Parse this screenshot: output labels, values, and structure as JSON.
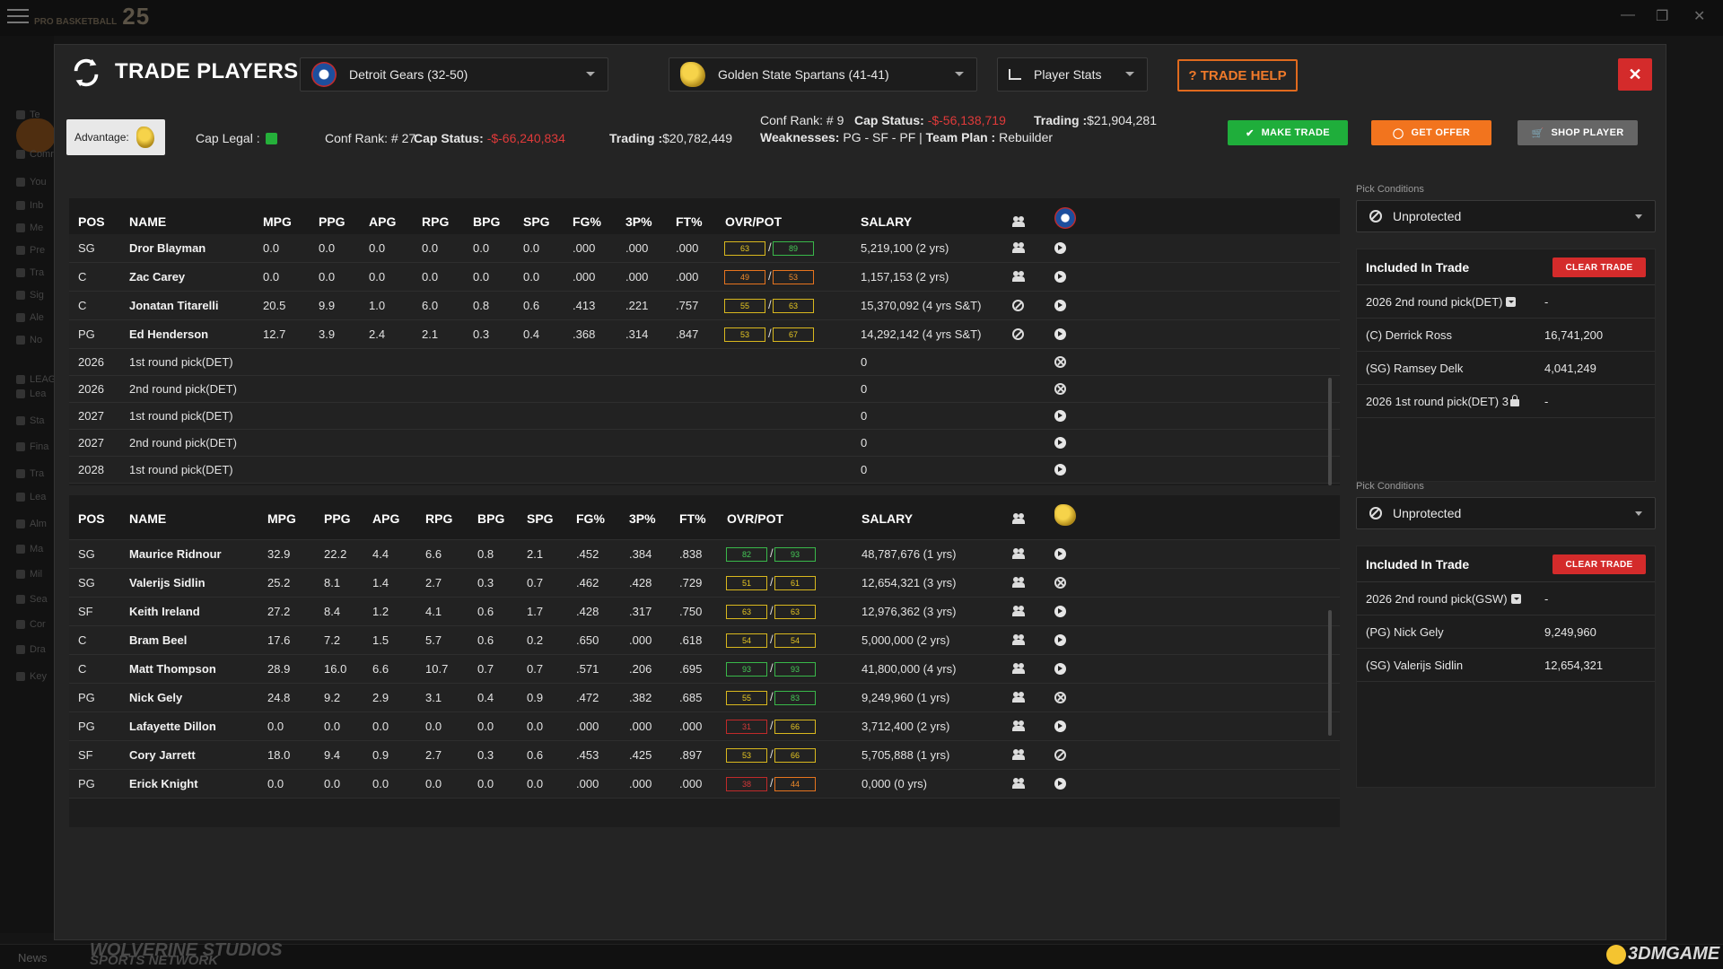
{
  "app": {
    "logo_small": "PRO BASKETBALL",
    "logo_year": "25",
    "news_label": "News",
    "studio": "WOLVERINE STUDIOS",
    "studio_sub": "SPORTS NETWORK",
    "watermark": "3DMGAME",
    "sidebar": [
      "Te",
      "Comr",
      "You",
      "Inb",
      "Me",
      "Pre",
      "Tra",
      "Sig",
      "Ale",
      "No",
      "LEAGUE",
      "Lea",
      "Sta",
      "Fina",
      "Tra",
      "Lea",
      "Alm",
      "Ma",
      "Mil",
      "Sea",
      "Cor",
      "Dra",
      "Key"
    ]
  },
  "modal": {
    "title": "TRADE PLAYERS",
    "team_left": "Detroit Gears (32-50)",
    "team_right": "Golden State Spartans (41-41)",
    "view_select": "Player Stats",
    "help_label": "? TRADE HELP",
    "close_label": "✕",
    "advantage_label": "Advantage:",
    "cap_legal_label": "Cap Legal :",
    "left_info": {
      "conf_rank_label": "Conf Rank: #",
      "conf_rank": "27",
      "cap_status_label": "Cap Status:",
      "cap_status": "-$-66,240,834",
      "trading_label": "Trading :",
      "trading": "$20,782,449"
    },
    "right_info": {
      "conf_rank_label": "Conf Rank: #",
      "conf_rank": "9",
      "cap_status_label": "Cap Status:",
      "cap_status": "-$-56,138,719",
      "trading_label": "Trading :",
      "trading": "$21,904,281",
      "weaknesses_label": "Weaknesses:",
      "weaknesses": "PG - SF - PF",
      "team_plan_label": "Team Plan :",
      "team_plan": "Rebuilder"
    },
    "buttons": {
      "make_trade": "MAKE TRADE",
      "get_offer": "GET OFFER",
      "shop_player": "SHOP PLAYER"
    },
    "columns": [
      "POS",
      "NAME",
      "MPG",
      "PPG",
      "APG",
      "RPG",
      "BPG",
      "SPG",
      "FG%",
      "3P%",
      "FT%",
      "OVR/POT",
      "SALARY"
    ],
    "top_rows": [
      {
        "pos": "SG",
        "name": "Dror Blayman",
        "mpg": "0.0",
        "ppg": "0.0",
        "apg": "0.0",
        "rpg": "0.0",
        "bpg": "0.0",
        "spg": "0.0",
        "fg": ".000",
        "tp": ".000",
        "ft": ".000",
        "ovr": "63",
        "ovr_c": "y",
        "pot": "89",
        "pot_c": "g",
        "salary": "5,219,100 (2 yrs)",
        "icon1": "people",
        "icon2": "arrow"
      },
      {
        "pos": "C",
        "name": "Zac Carey",
        "mpg": "0.0",
        "ppg": "0.0",
        "apg": "0.0",
        "rpg": "0.0",
        "bpg": "0.0",
        "spg": "0.0",
        "fg": ".000",
        "tp": ".000",
        "ft": ".000",
        "ovr": "49",
        "ovr_c": "o",
        "pot": "53",
        "pot_c": "o",
        "salary": "1,157,153 (2 yrs)",
        "icon1": "people",
        "icon2": "arrow"
      },
      {
        "pos": "C",
        "name": "Jonatan Titarelli",
        "mpg": "20.5",
        "ppg": "9.9",
        "apg": "1.0",
        "rpg": "6.0",
        "bpg": "0.8",
        "spg": "0.6",
        "fg": ".413",
        "tp": ".221",
        "ft": ".757",
        "ovr": "55",
        "ovr_c": "y",
        "pot": "63",
        "pot_c": "y",
        "salary": "15,370,092 (4 yrs S&T)",
        "icon1": "ban",
        "icon2": "arrow"
      },
      {
        "pos": "PG",
        "name": "Ed Henderson",
        "mpg": "12.7",
        "ppg": "3.9",
        "apg": "2.4",
        "rpg": "2.1",
        "bpg": "0.3",
        "spg": "0.4",
        "fg": ".368",
        "tp": ".314",
        "ft": ".847",
        "ovr": "53",
        "ovr_c": "y",
        "pot": "67",
        "pot_c": "y",
        "salary": "14,292,142 (4 yrs S&T)",
        "icon1": "ban",
        "icon2": "arrow"
      }
    ],
    "top_picks": [
      {
        "year": "2026",
        "name": "1st round pick(DET)",
        "salary": "0",
        "icon": "x"
      },
      {
        "year": "2026",
        "name": "2nd round pick(DET)",
        "salary": "0",
        "icon": "x"
      },
      {
        "year": "2027",
        "name": "1st round pick(DET)",
        "salary": "0",
        "icon": "arrow"
      },
      {
        "year": "2027",
        "name": "2nd round pick(DET)",
        "salary": "0",
        "icon": "arrow"
      },
      {
        "year": "2028",
        "name": "1st round pick(DET)",
        "salary": "0",
        "icon": "arrow"
      }
    ],
    "bottom_rows": [
      {
        "pos": "SG",
        "name": "Maurice Ridnour",
        "mpg": "32.9",
        "ppg": "22.2",
        "apg": "4.4",
        "rpg": "6.6",
        "bpg": "0.8",
        "spg": "2.1",
        "fg": ".452",
        "tp": ".384",
        "ft": ".838",
        "ovr": "82",
        "ovr_c": "g",
        "pot": "93",
        "pot_c": "g",
        "salary": "48,787,676 (1 yrs)",
        "icon1": "people",
        "icon2": "arrow"
      },
      {
        "pos": "SG",
        "name": "Valerijs Sidlin",
        "mpg": "25.2",
        "ppg": "8.1",
        "apg": "1.4",
        "rpg": "2.7",
        "bpg": "0.3",
        "spg": "0.7",
        "fg": ".462",
        "tp": ".428",
        "ft": ".729",
        "ovr": "51",
        "ovr_c": "y",
        "pot": "61",
        "pot_c": "y",
        "salary": "12,654,321 (3 yrs)",
        "icon1": "people",
        "icon2": "x"
      },
      {
        "pos": "SF",
        "name": "Keith Ireland",
        "mpg": "27.2",
        "ppg": "8.4",
        "apg": "1.2",
        "rpg": "4.1",
        "bpg": "0.6",
        "spg": "1.7",
        "fg": ".428",
        "tp": ".317",
        "ft": ".750",
        "ovr": "63",
        "ovr_c": "y",
        "pot": "63",
        "pot_c": "y",
        "salary": "12,976,362 (3 yrs)",
        "icon1": "people",
        "icon2": "arrow"
      },
      {
        "pos": "C",
        "name": "Bram Beel",
        "mpg": "17.6",
        "ppg": "7.2",
        "apg": "1.5",
        "rpg": "5.7",
        "bpg": "0.6",
        "spg": "0.2",
        "fg": ".650",
        "tp": ".000",
        "ft": ".618",
        "ovr": "54",
        "ovr_c": "y",
        "pot": "54",
        "pot_c": "y",
        "salary": "5,000,000 (2 yrs)",
        "icon1": "people",
        "icon2": "arrow"
      },
      {
        "pos": "C",
        "name": "Matt Thompson",
        "mpg": "28.9",
        "ppg": "16.0",
        "apg": "6.6",
        "rpg": "10.7",
        "bpg": "0.7",
        "spg": "0.7",
        "fg": ".571",
        "tp": ".206",
        "ft": ".695",
        "ovr": "93",
        "ovr_c": "g",
        "pot": "93",
        "pot_c": "g",
        "salary": "41,800,000 (4 yrs)",
        "icon1": "people",
        "icon2": "arrow"
      },
      {
        "pos": "PG",
        "name": "Nick Gely",
        "mpg": "24.8",
        "ppg": "9.2",
        "apg": "2.9",
        "rpg": "3.1",
        "bpg": "0.4",
        "spg": "0.9",
        "fg": ".472",
        "tp": ".382",
        "ft": ".685",
        "ovr": "55",
        "ovr_c": "y",
        "pot": "83",
        "pot_c": "g",
        "salary": "9,249,960 (1 yrs)",
        "icon1": "people",
        "icon2": "x"
      },
      {
        "pos": "PG",
        "name": "Lafayette Dillon",
        "mpg": "0.0",
        "ppg": "0.0",
        "apg": "0.0",
        "rpg": "0.0",
        "bpg": "0.0",
        "spg": "0.0",
        "fg": ".000",
        "tp": ".000",
        "ft": ".000",
        "ovr": "31",
        "ovr_c": "r",
        "pot": "66",
        "pot_c": "y",
        "salary": "3,712,400 (2 yrs)",
        "icon1": "people",
        "icon2": "arrow"
      },
      {
        "pos": "SF",
        "name": "Cory Jarrett",
        "mpg": "18.0",
        "ppg": "9.4",
        "apg": "0.9",
        "rpg": "2.7",
        "bpg": "0.3",
        "spg": "0.6",
        "fg": ".453",
        "tp": ".425",
        "ft": ".897",
        "ovr": "53",
        "ovr_c": "y",
        "pot": "66",
        "pot_c": "y",
        "salary": "5,705,888 (1 yrs)",
        "icon1": "people",
        "icon2": "ban"
      },
      {
        "pos": "PG",
        "name": "Erick Knight",
        "mpg": "0.0",
        "ppg": "0.0",
        "apg": "0.0",
        "rpg": "0.0",
        "bpg": "0.0",
        "spg": "0.0",
        "fg": ".000",
        "tp": ".000",
        "ft": ".000",
        "ovr": "38",
        "ovr_c": "r",
        "pot": "44",
        "pot_c": "o",
        "salary": "0,000 (0 yrs)",
        "icon1": "people",
        "icon2": "arrow"
      }
    ],
    "top_panel": {
      "pick_conditions_label": "Pick Conditions",
      "pick_condition": "Unprotected",
      "included_label": "Included In Trade",
      "clear_label": "CLEAR TRADE",
      "items": [
        {
          "label": "2026 2nd round pick(DET)",
          "value": "-",
          "suffix": "tag"
        },
        {
          "label": "(C) Derrick Ross",
          "value": "16,741,200",
          "suffix": ""
        },
        {
          "label": "(SG) Ramsey Delk",
          "value": "4,041,249",
          "suffix": ""
        },
        {
          "label": "2026 1st round pick(DET) 3",
          "value": "-",
          "suffix": "lock"
        }
      ]
    },
    "bottom_panel": {
      "pick_conditions_label": "Pick Conditions",
      "pick_condition": "Unprotected",
      "included_label": "Included In Trade",
      "clear_label": "CLEAR TRADE",
      "items": [
        {
          "label": "2026 2nd round pick(GSW)",
          "value": "-",
          "suffix": "tag"
        },
        {
          "label": "(PG) Nick Gely",
          "value": "9,249,960",
          "suffix": ""
        },
        {
          "label": "(SG) Valerijs Sidlin",
          "value": "12,654,321",
          "suffix": ""
        }
      ]
    }
  }
}
